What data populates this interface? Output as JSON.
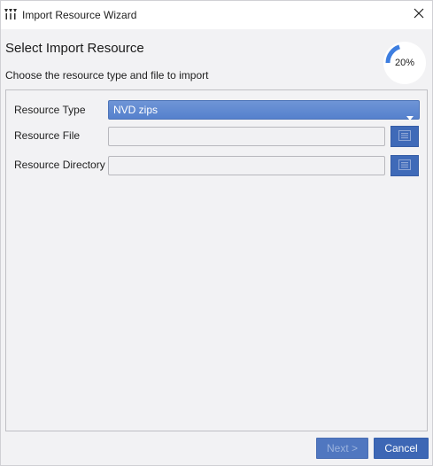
{
  "window": {
    "title": "Import Resource Wizard",
    "app_icon": "vendor-logo-icon",
    "close_icon": "close-icon"
  },
  "header": {
    "title": "Select Import Resource",
    "subtitle": "Choose the resource type and file to import",
    "progress_label": "20%",
    "progress_fraction": 0.2
  },
  "form": {
    "resource_type_label": "Resource Type",
    "resource_type_value": "NVD zips",
    "resource_file_label": "Resource File",
    "resource_file_value": "",
    "resource_directory_label": "Resource Directory",
    "resource_directory_value": "",
    "browse_icon": "folder-browse-icon"
  },
  "buttons": {
    "next_label": "Next >",
    "cancel_label": "Cancel"
  },
  "colors": {
    "accent": "#3d67b5",
    "select_bg": "#5f89d0",
    "progress_arc": "#3d7ee0"
  }
}
